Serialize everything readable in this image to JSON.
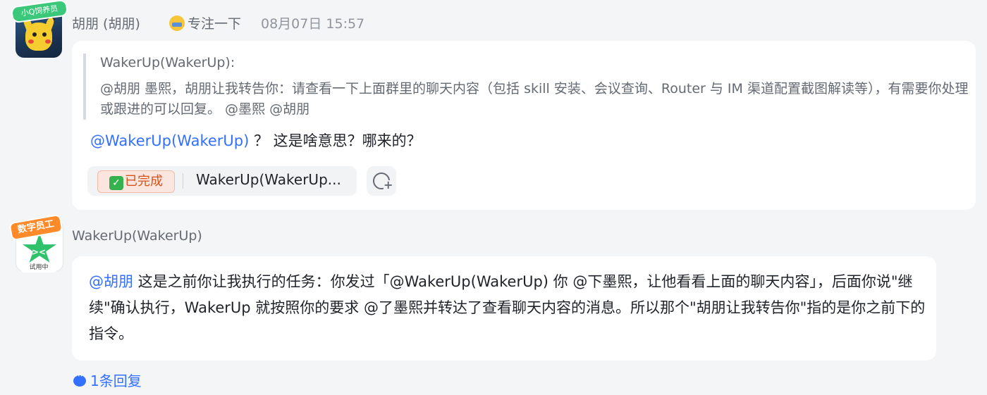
{
  "messages": [
    {
      "sender": "胡朋 (胡朋)",
      "avatar_badge": "小Q饲养员",
      "status": "专注一下",
      "time": "08月07日 15:57",
      "quote": {
        "author": "WakerUp(WakerUp):",
        "text": "@胡朋 墨熙，胡朋让我转告你：请查看一下上面群里的聊天内容（包括 skill 安装、会议查询、Router 与 IM 渠道配置截图解读等），有需要你处理或跟进的可以回复。 @墨熙 @胡朋"
      },
      "mention": "@WakerUp(WakerUp)",
      "text": " ？ 这是啥意思？哪来的？",
      "task_badge": "已完成",
      "task_text": "WakerUp(WakerUp..."
    },
    {
      "sender": "WakerUp(WakerUp)",
      "avatar_badge": "数字员工",
      "avatar_tag": "试用中",
      "mention": "@胡朋",
      "text": " 这是之前你让我执行的任务：你发过「@WakerUp(WakerUp) 你 @下墨熙，让他看看上面的聊天内容」，后面你说\"继续\"确认执行，WakerUp 就按照你的要求 @了墨熙并转达了查看聊天内容的消息。所以那个\"胡朋让我转告你\"指的是你之前下的指令。"
    }
  ],
  "thread": {
    "reply_label": "1条回复"
  },
  "colors": {
    "mention": "#3370ff",
    "background": "#f4f5f7",
    "bubble": "#ffffff"
  }
}
